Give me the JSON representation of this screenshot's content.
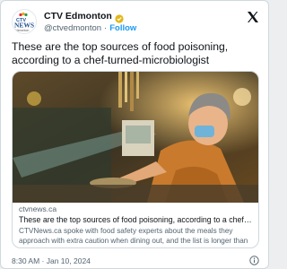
{
  "author": {
    "display_name": "CTV Edmonton",
    "handle": "@ctvedmonton",
    "follow_label": "Follow",
    "logo_text_top": "CTV",
    "logo_text_main": "NEWS",
    "logo_text_sub": "Edmonton",
    "verified_icon": "gold-verified-badge-icon"
  },
  "tweet": {
    "text": "These are the top sources of food poisoning, according to a chef-turned-microbiologist"
  },
  "link_card": {
    "domain": "ctvnews.ca",
    "title": "These are the top sources of food poisoning, according to a chef-turne…",
    "description": "CTVNews.ca spoke with food safety experts about the meals they approach with extra caution when dining out, and the list is longer than …"
  },
  "footer": {
    "timestamp": "8:30 AM · Jan 10, 2024",
    "info_icon": "info-icon"
  },
  "colors": {
    "link_blue": "#1d9bf0",
    "secondary_text": "#536471",
    "verified_gold": "#e2b719"
  }
}
